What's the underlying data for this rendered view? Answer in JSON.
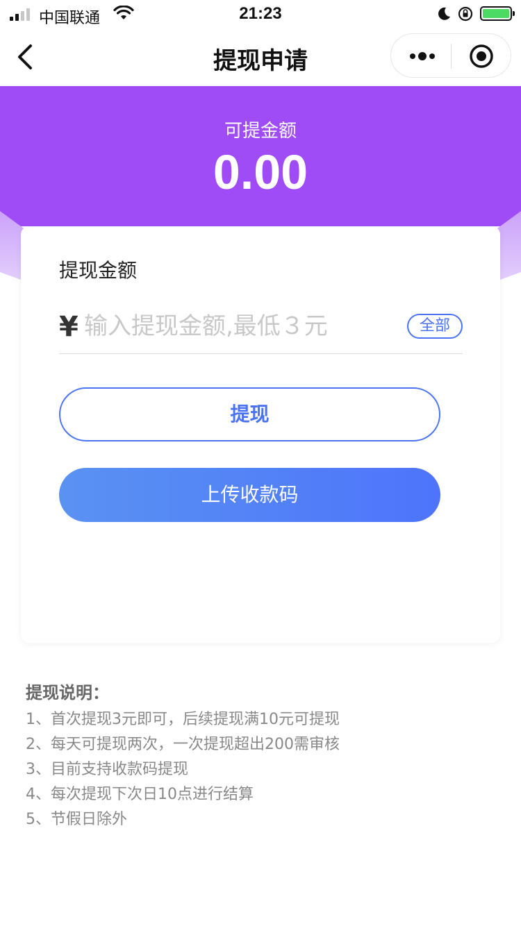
{
  "status_bar": {
    "carrier": "中国联通",
    "time": "21:23"
  },
  "nav": {
    "title": "提现申请"
  },
  "hero": {
    "label": "可提金额",
    "amount": "0.00"
  },
  "card": {
    "title": "提现金额",
    "currency_symbol": "¥",
    "amount_placeholder": "输入提现金额,最低３元",
    "all_label": "全部",
    "withdraw_label": "提现",
    "upload_label": "上传收款码"
  },
  "notes": {
    "title": "提现说明：",
    "items": [
      "1、首次提现3元即可，后续提现满10元可提现",
      "2、每天可提现两次，一次提现超出200需审核",
      "3、目前支持收款码提现",
      "4、每次提现下次日10点进行结算",
      "5、节假日除外"
    ]
  },
  "colors": {
    "hero_purple": "#a04cf6",
    "accent_blue": "#4a73f3",
    "battery_green": "#4cd964"
  },
  "icons": [
    "signal-icon",
    "wifi-icon",
    "moon-icon",
    "orientation-lock-icon",
    "battery-icon",
    "back-arrow-icon",
    "more-icon",
    "target-icon"
  ]
}
